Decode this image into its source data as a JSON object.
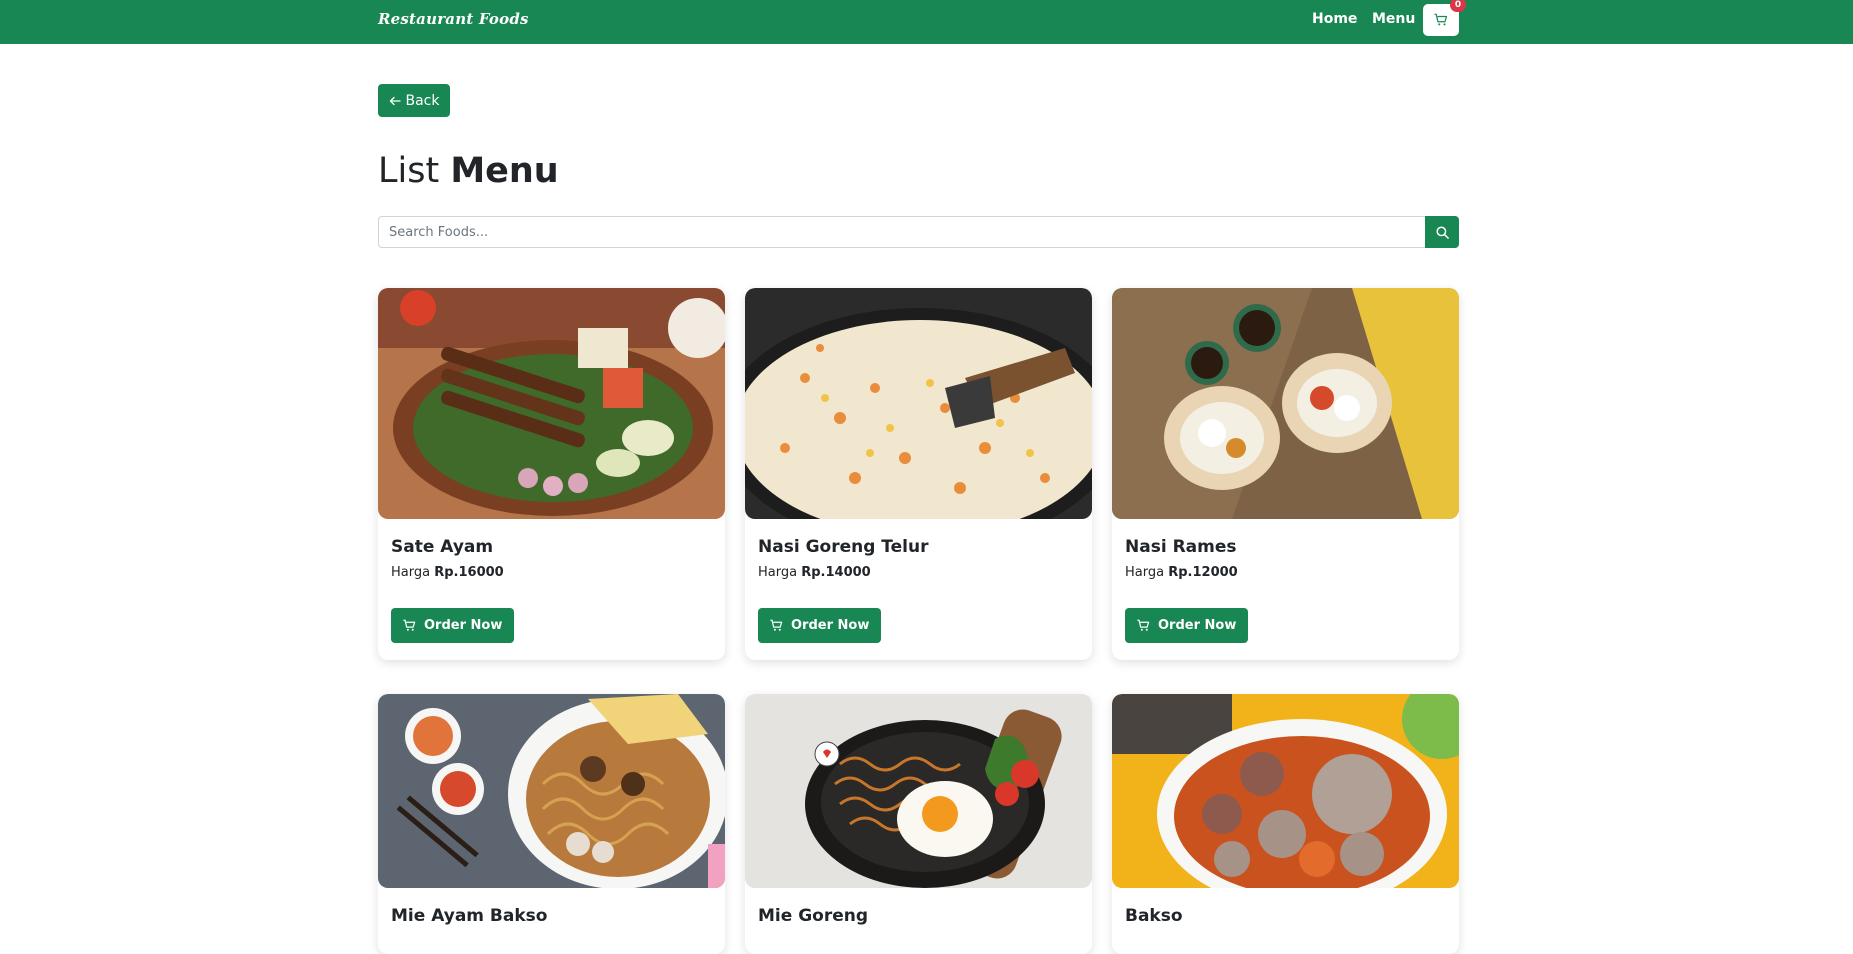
{
  "navbar": {
    "brand": "Restaurant Foods",
    "links": [
      "Home",
      "Menu"
    ],
    "cart_count": "0",
    "bg_color": "#198754"
  },
  "back_button": {
    "label": "Back",
    "icon": "arrow-left-icon"
  },
  "page_title": {
    "regular": "List",
    "bold": "Menu"
  },
  "search": {
    "placeholder": "Search Foods...",
    "value": "",
    "icon": "search-icon"
  },
  "price_prefix": "Harga",
  "order_label": "Order Now",
  "foods": [
    {
      "name": "Sate Ayam",
      "price": "Rp.16000"
    },
    {
      "name": "Nasi Goreng Telur",
      "price": "Rp.14000"
    },
    {
      "name": "Nasi Rames",
      "price": "Rp.12000"
    },
    {
      "name": "Mie Ayam Bakso"
    },
    {
      "name": "Mie Goreng"
    },
    {
      "name": "Bakso"
    }
  ],
  "colors": {
    "accent": "#198754",
    "badge": "#dc3545"
  }
}
